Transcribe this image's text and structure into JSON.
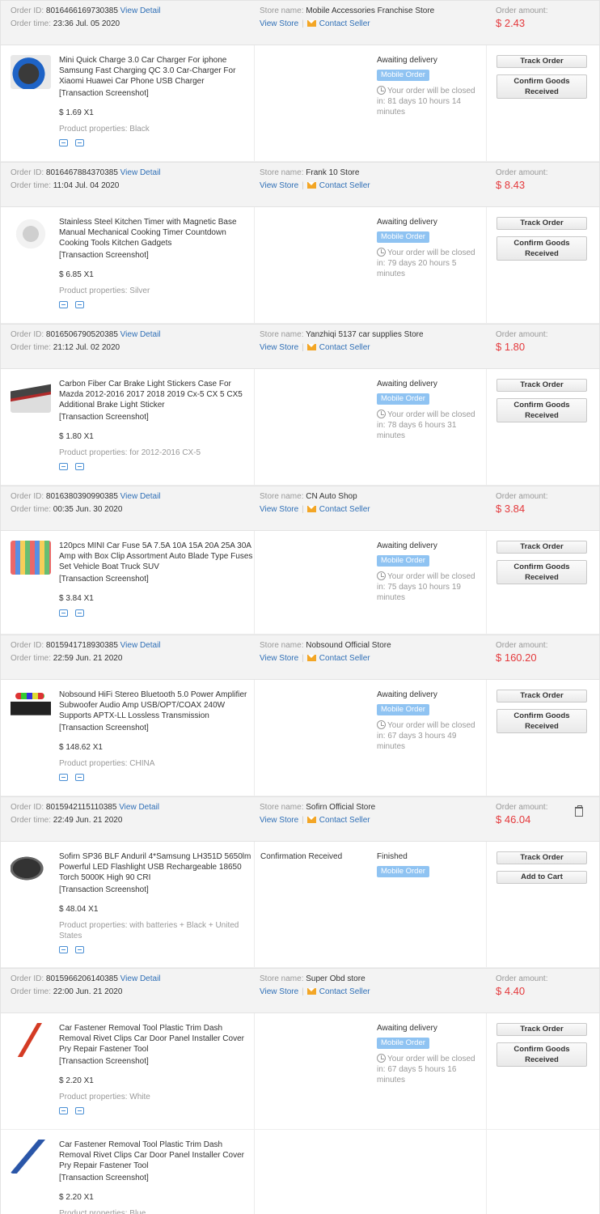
{
  "labels": {
    "order_id": "Order ID:",
    "order_time": "Order time:",
    "view_detail": "View Detail",
    "store_name": "Store name:",
    "view_store": "View Store",
    "contact_seller": "Contact Seller",
    "order_amount": "Order amount:",
    "transaction_screenshot": "[Transaction Screenshot]",
    "product_properties": "Product properties:",
    "mobile_order": "Mobile Order",
    "track_order": "Track Order",
    "confirm_goods": "Confirm Goods Received",
    "add_to_cart": "Add to Cart",
    "separator": "|"
  },
  "orders": [
    {
      "order_id": "8016466169730385",
      "order_time": "23:36 Jul. 05 2020",
      "store": "Mobile Accessories Franchise Store",
      "amount": "$ 2.43",
      "deletable": false,
      "items": [
        {
          "thumb": "t1",
          "title": "Mini Quick Charge 3.0 Car Charger For iphone Samsung Fast Charging QC 3.0 Car-Charger For Xiaomi Huawei Car Phone USB Charger",
          "price": "$ 1.69 X1",
          "properties": "Black",
          "status": "Awaiting delivery",
          "countdown": "Your order will be closed in: 81 days 10 hours 14 minutes",
          "buttons": [
            "track_order",
            "confirm_goods"
          ]
        }
      ]
    },
    {
      "order_id": "8016467884370385",
      "order_time": "11:04 Jul. 04 2020",
      "store": "Frank 10 Store",
      "amount": "$ 8.43",
      "deletable": false,
      "items": [
        {
          "thumb": "t2",
          "title": "Stainless Steel Kitchen Timer with Magnetic Base Manual Mechanical Cooking Timer Countdown Cooking Tools Kitchen Gadgets",
          "price": "$ 6.85 X1",
          "properties": "Silver",
          "status": "Awaiting delivery",
          "countdown": "Your order will be closed in: 79 days 20 hours 5 minutes",
          "buttons": [
            "track_order",
            "confirm_goods"
          ]
        }
      ]
    },
    {
      "order_id": "8016506790520385",
      "order_time": "21:12 Jul. 02 2020",
      "store": "Yanzhiqi 5137 car supplies Store",
      "amount": "$ 1.80",
      "deletable": false,
      "items": [
        {
          "thumb": "t3",
          "title": "Carbon Fiber Car Brake Light Stickers Case For Mazda 2012-2016 2017 2018 2019 Cx-5 CX 5 CX5 Additional Brake Light Sticker",
          "price": "$ 1.80 X1",
          "properties": "for 2012-2016 CX-5",
          "status": "Awaiting delivery",
          "countdown": "Your order will be closed in: 78 days 6 hours 31 minutes",
          "buttons": [
            "track_order",
            "confirm_goods"
          ]
        }
      ]
    },
    {
      "order_id": "8016380390990385",
      "order_time": "00:35 Jun. 30 2020",
      "store": "CN Auto Shop",
      "amount": "$ 3.84",
      "deletable": false,
      "items": [
        {
          "thumb": "t4",
          "title": "120pcs MINI Car Fuse 5A 7.5A 10A 15A 20A 25A 30A Amp with Box Clip Assortment Auto Blade Type Fuses Set Vehicle Boat Truck SUV",
          "price": "$ 3.84 X1",
          "properties": "",
          "status": "Awaiting delivery",
          "countdown": "Your order will be closed in: 75 days 10 hours 19 minutes",
          "buttons": [
            "track_order",
            "confirm_goods"
          ]
        }
      ]
    },
    {
      "order_id": "8015941718930385",
      "order_time": "22:59 Jun. 21 2020",
      "store": "Nobsound Official Store",
      "amount": "$ 160.20",
      "deletable": false,
      "items": [
        {
          "thumb": "t5",
          "title": "Nobsound HiFi Stereo Bluetooth 5.0 Power Amplifier Subwoofer Audio Amp USB/OPT/COAX 240W Supports APTX-LL Lossless Transmission",
          "price": "$ 148.62 X1",
          "properties": "CHINA",
          "status": "Awaiting delivery",
          "countdown": "Your order will be closed in: 67 days 3 hours 49 minutes",
          "buttons": [
            "track_order",
            "confirm_goods"
          ]
        }
      ]
    },
    {
      "order_id": "8015942115110385",
      "order_time": "22:49 Jun. 21 2020",
      "store": "Sofirn Official Store",
      "amount": "$ 46.04",
      "deletable": true,
      "items": [
        {
          "thumb": "t6",
          "title": "Sofirn SP36 BLF Anduril 4*Samsung LH351D 5650lm Powerful LED Flashlight USB Rechargeable 18650 Torch 5000K High 90 CRI",
          "price": "$ 48.04 X1",
          "properties": "with batteries + Black + United States",
          "confirm_received": "Confirmation Received",
          "status": "Finished",
          "countdown": "",
          "buttons": [
            "track_order",
            "add_to_cart"
          ]
        }
      ]
    },
    {
      "order_id": "8015966206140385",
      "order_time": "22:00 Jun. 21 2020",
      "store": "Super Obd store",
      "amount": "$ 4.40",
      "deletable": false,
      "items": [
        {
          "thumb": "t7",
          "title": "Car Fastener Removal Tool Plastic Trim Dash Removal Rivet Clips Car Door Panel Installer Cover Pry Repair Fastener Tool",
          "price": "$ 2.20 X1",
          "properties": "White",
          "status": "Awaiting delivery",
          "countdown": "Your order will be closed in: 67 days 5 hours 16 minutes",
          "buttons": [
            "track_order",
            "confirm_goods"
          ]
        },
        {
          "thumb": "t8",
          "title": "Car Fastener Removal Tool Plastic Trim Dash Removal Rivet Clips Car Door Panel Installer Cover Pry Repair Fastener Tool",
          "price": "$ 2.20 X1",
          "properties": "Blue",
          "status": "",
          "countdown": "",
          "buttons": []
        }
      ]
    }
  ]
}
